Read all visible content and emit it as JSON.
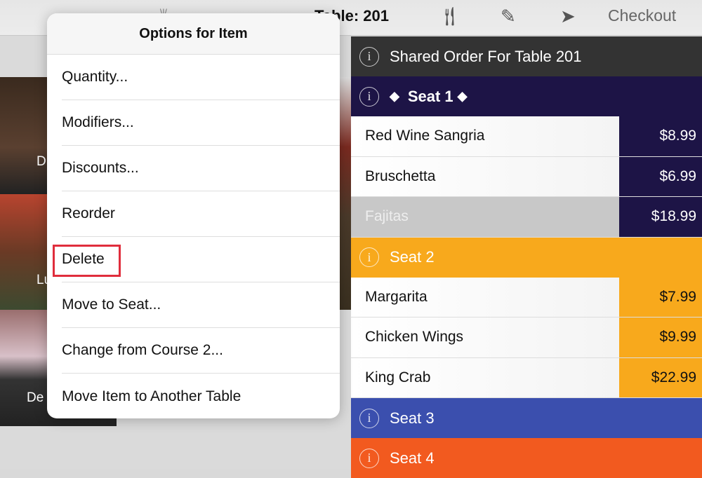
{
  "topbar": {
    "title": "Table: 201",
    "icons": [
      "loading-spinner-icon",
      "utensils-icon",
      "pencil-icon",
      "send-icon"
    ],
    "checkout_label": "Checkout"
  },
  "categories": [
    {
      "label": "D"
    },
    {
      "label": "Lu"
    },
    {
      "label": "De"
    }
  ],
  "order": {
    "shared_header": "Shared Order For Table 201",
    "seats": [
      {
        "label": "Seat 1",
        "selected": true,
        "color": "#1d1446",
        "text_color": "#ffffff",
        "items": [
          {
            "name": "Red Wine Sangria",
            "price": "$8.99"
          },
          {
            "name": "Bruschetta",
            "price": "$6.99"
          },
          {
            "name": "Fajitas",
            "price": "$18.99",
            "highlighted": true
          }
        ]
      },
      {
        "label": "Seat 2",
        "color": "#f8a91c",
        "text_color": "#111111",
        "items": [
          {
            "name": "Margarita",
            "price": "$7.99"
          },
          {
            "name": "Chicken Wings",
            "price": "$9.99"
          },
          {
            "name": "King Crab",
            "price": "$22.99"
          }
        ]
      },
      {
        "label": "Seat 3",
        "color": "#3b4fae",
        "items": []
      },
      {
        "label": "Seat 4",
        "color": "#f25a1f",
        "items": []
      }
    ]
  },
  "popup": {
    "title": "Options for Item",
    "options": [
      "Quantity...",
      "Modifiers...",
      "Discounts...",
      "Reorder",
      "Delete",
      "Move to Seat...",
      "Change from Course 2...",
      "Move Item to Another Table"
    ],
    "highlighted_option": "Delete",
    "highlight_color": "#e02d3c"
  }
}
